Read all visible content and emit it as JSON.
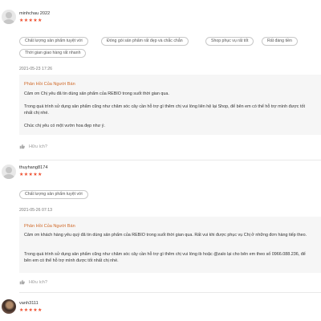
{
  "reviews": [
    {
      "username": "minhchau 2022",
      "stars": "★★★★★",
      "tags": [
        "Chất lượng sản phẩm tuyệt vời",
        "Đóng gói sản phẩm rất đẹp và chắc chắn",
        "Shop phục vụ rất tốt",
        "Rất đáng tiền",
        "Thời gian giao hàng rất nhanh"
      ],
      "date": "2021-05-23 17:26",
      "reply_title": "Phản Hồi Của Người Bán",
      "reply_lines": [
        "Cảm ơn Chị yêu đã tin dùng sản phẩm của REBIO trong suốt thời gian qua.",
        "Trong quá trình sử dụng sản phẩm cũng như chăm sóc cây cần hỗ trợ gì thêm chị vui lòng liên hệ lại Shop, để bên em có thể hỗ trợ mình được tốt nhất chị nhé.",
        "Chúc chị yêu có một vườn hoa đẹp như ý."
      ],
      "like_label": "Hữu ích?"
    },
    {
      "username": "thuyhang8174",
      "stars": "★★★★★",
      "tags": [
        "Chất lượng sản phẩm tuyệt vời"
      ],
      "date": "2021-05-26 07:13",
      "reply_title": "Phản Hồi Của Người Bán",
      "reply_lines": [
        "Cảm ơn khách hàng yêu quý đã tin dùng sản phẩm của REBIO trong suốt thời gian qua. Rất vui khi được phục vụ Chị ở những đơn hàng tiếp theo.",
        "Trong quá trình sử dụng sản phẩm cũng như chăm sóc cây cần hỗ trợ gì thêm chị vui lòng ib hoặc @zalo lại cho bên em theo số 0966.088.236, để bên em có thể hỗ trợ mình được tốt nhất chị nhé."
      ],
      "like_label": "Hữu ích?"
    },
    {
      "username": "vanh3111",
      "stars": "★★★★★"
    }
  ]
}
